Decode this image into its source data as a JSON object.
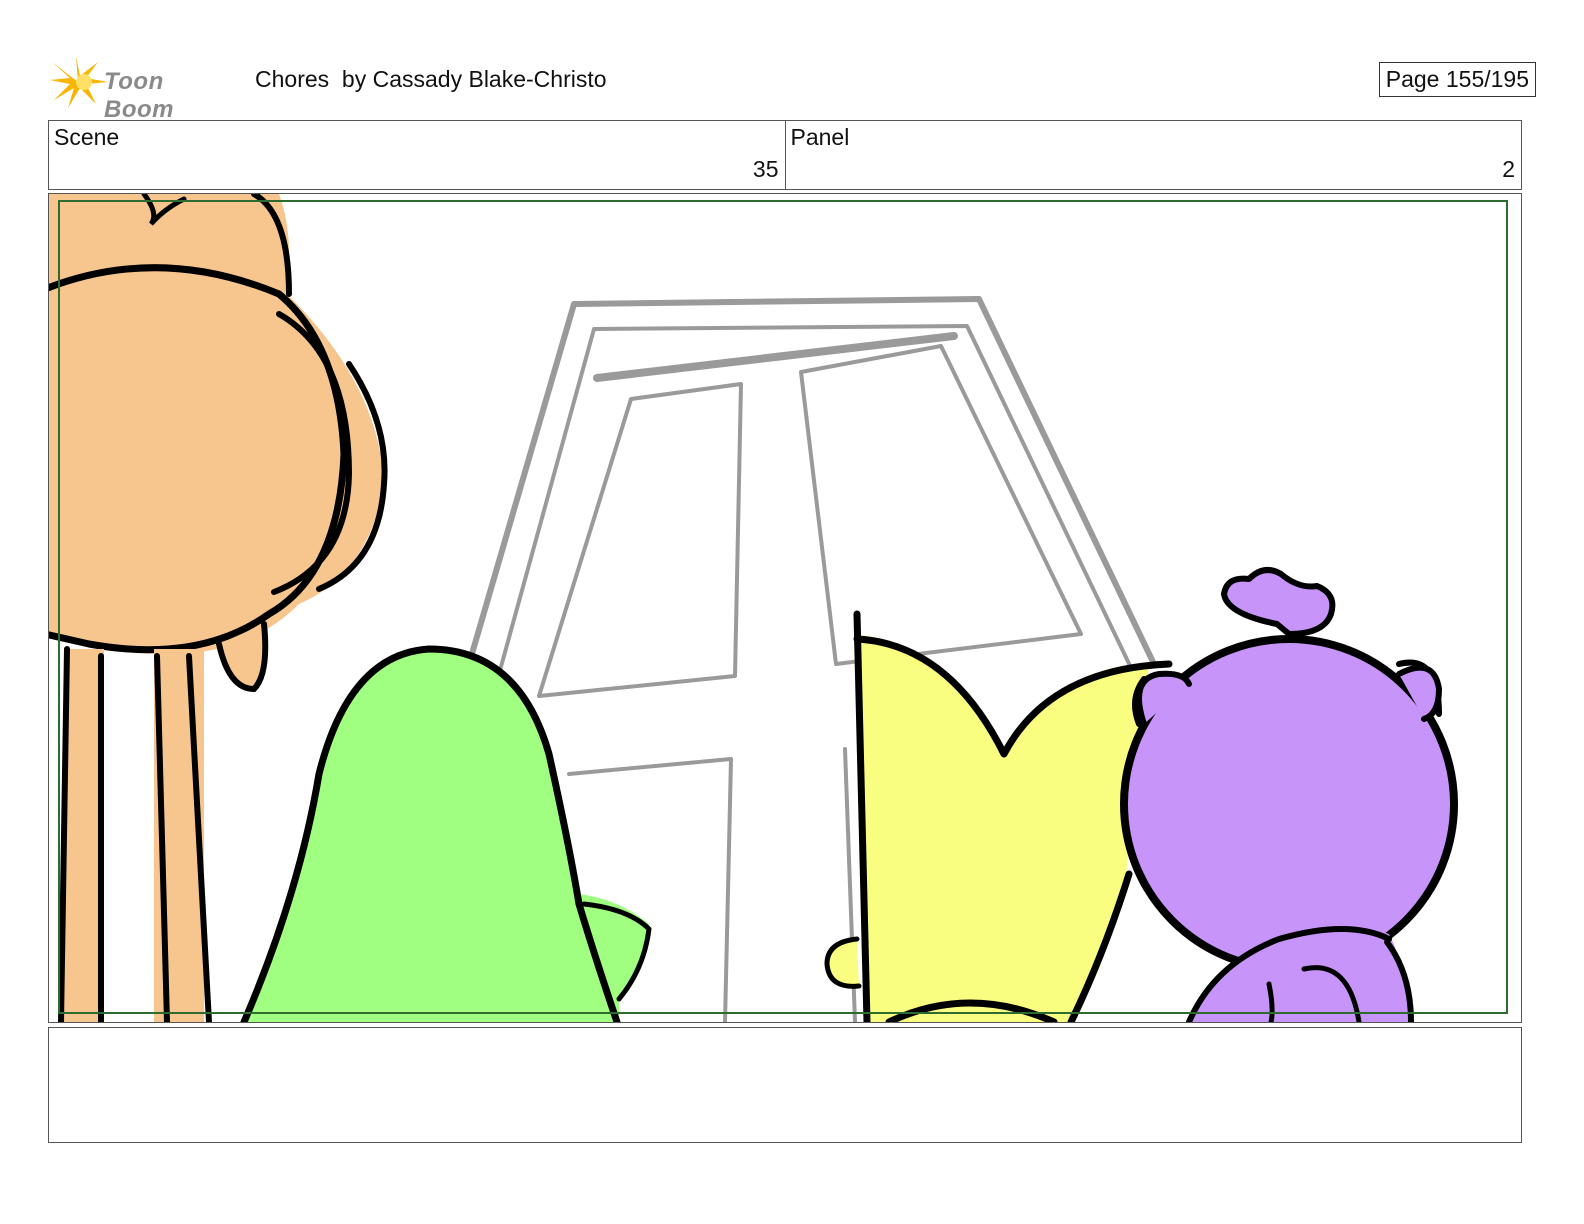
{
  "header": {
    "logo_text": "Toon Boom",
    "title": "Chores  by Cassady Blake-Christo",
    "page": "Page 155/195"
  },
  "info": {
    "scene_label": "Scene",
    "scene_value": "35",
    "panel_label": "Panel",
    "panel_value": "2"
  },
  "colors": {
    "orange_character": "#f7c68e",
    "green_character": "#a0fe80",
    "yellow_character": "#fafe80",
    "purple_character": "#c795f9",
    "door_sketch": "#9a9a9a",
    "safe_frame": "#2e6b2e"
  },
  "notes": {
    "text": ""
  }
}
